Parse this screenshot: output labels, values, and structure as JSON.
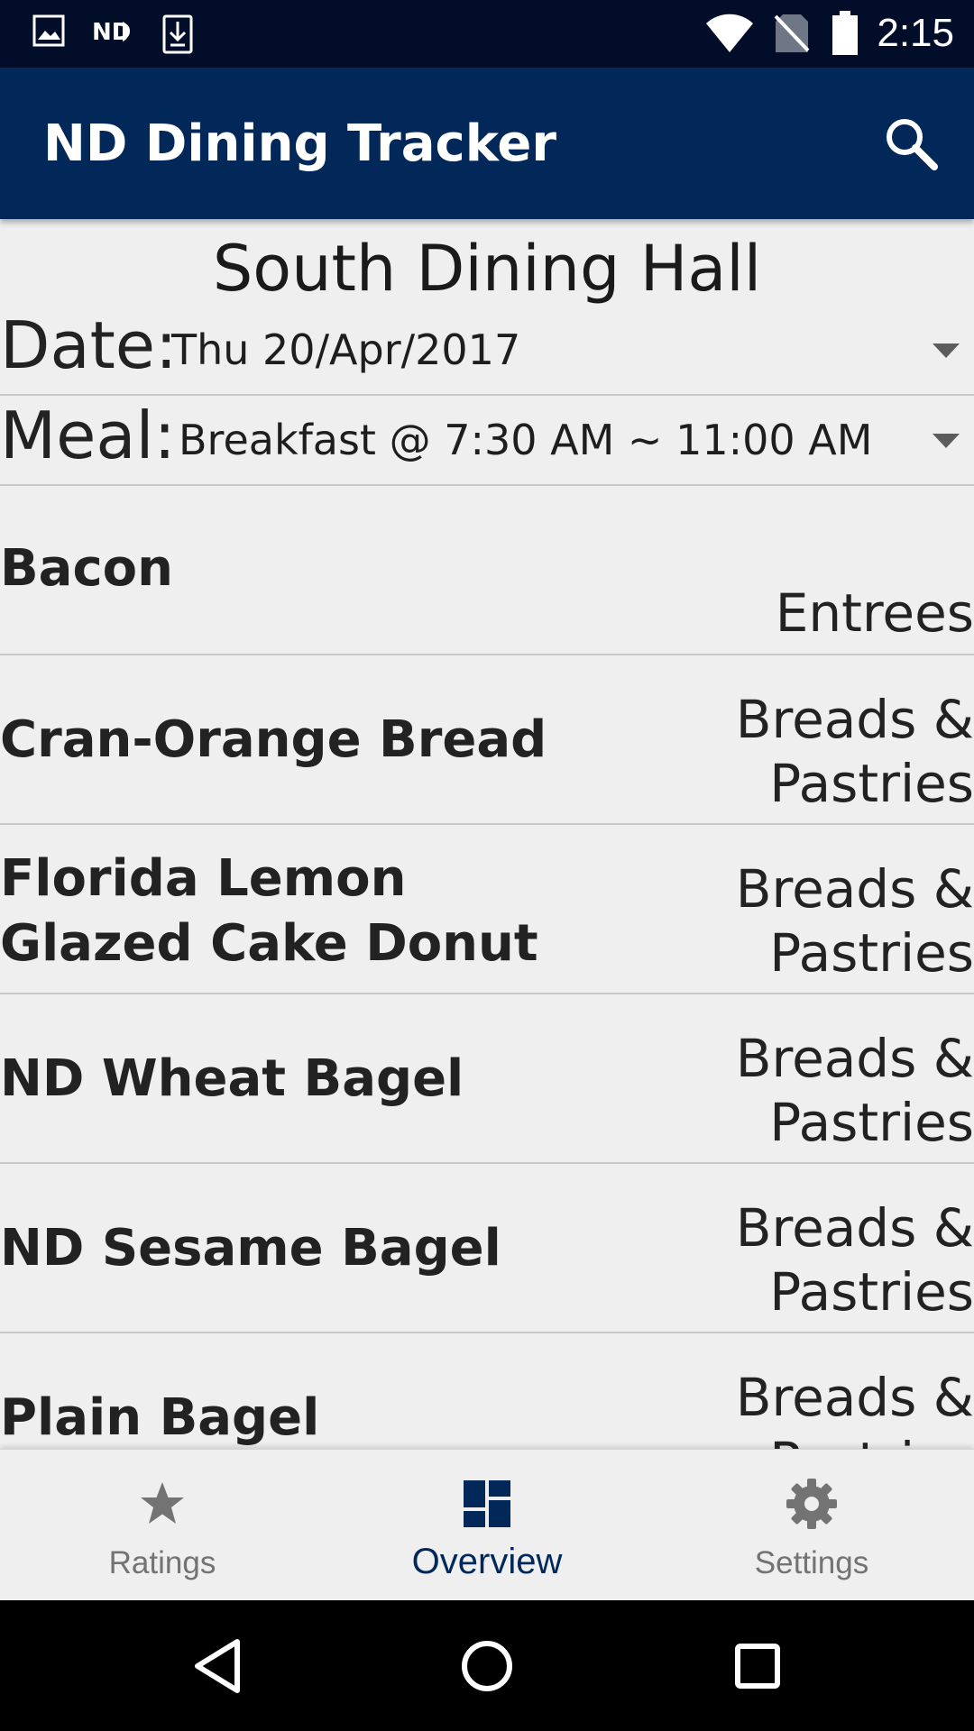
{
  "status_bar": {
    "time": "2:15",
    "left_icons": [
      "image-icon",
      "nd-logo-icon",
      "download-icon"
    ],
    "right_icons": [
      "wifi-icon",
      "no-sim-icon",
      "battery-icon"
    ]
  },
  "app_bar": {
    "title": "ND Dining Tracker",
    "search_icon": "search-icon"
  },
  "hall": {
    "name": "South Dining Hall"
  },
  "date_picker": {
    "label": "Date:",
    "value": "Thu 20/Apr/2017"
  },
  "meal_picker": {
    "label": "Meal:",
    "value": "Breakfast @ 7:30 AM ~ 11:00 AM"
  },
  "menu_items": [
    {
      "name": "Bacon",
      "category": "Entrees"
    },
    {
      "name": "Cran-Orange Bread",
      "category": "Breads & Pastries"
    },
    {
      "name": "Florida Lemon Glazed Cake Donut",
      "category": "Breads & Pastries"
    },
    {
      "name": "ND Wheat Bagel",
      "category": "Breads & Pastries"
    },
    {
      "name": "ND Sesame Bagel",
      "category": "Breads & Pastries"
    },
    {
      "name": "Plain Bagel",
      "category": "Breads & Pastries"
    }
  ],
  "bottom_nav": {
    "items": [
      {
        "label": "Ratings",
        "icon": "star-icon",
        "active": false
      },
      {
        "label": "Overview",
        "icon": "dashboard-icon",
        "active": true
      },
      {
        "label": "Settings",
        "icon": "gear-icon",
        "active": false
      }
    ]
  },
  "colors": {
    "status_bar": "#020e29",
    "app_bar": "#022759",
    "active_nav": "#022759",
    "inactive_nav": "#737373",
    "background": "#efefef"
  }
}
